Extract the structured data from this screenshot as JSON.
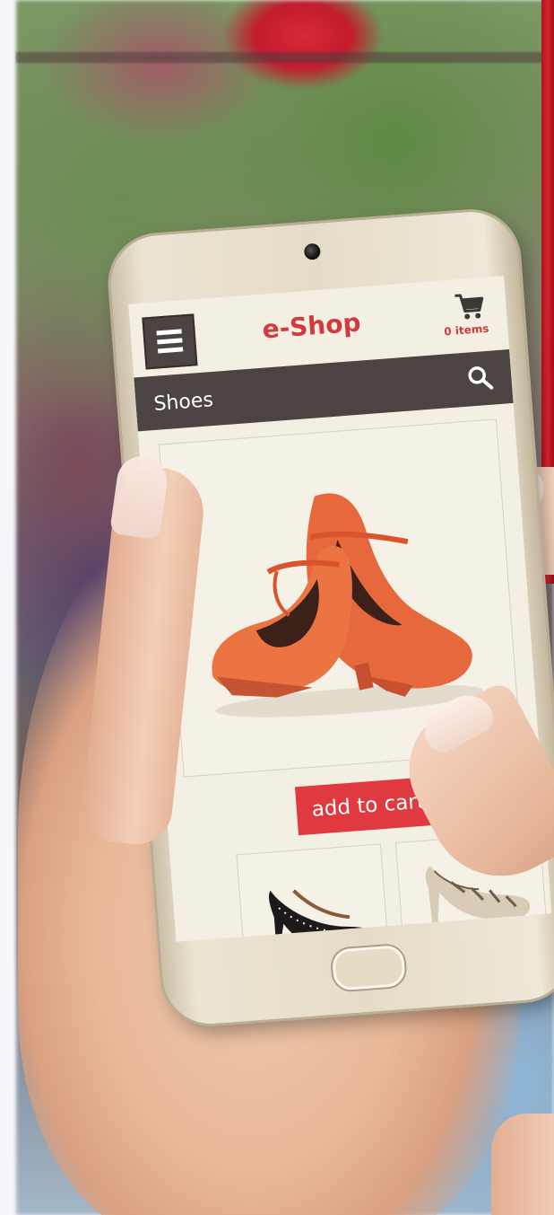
{
  "app": {
    "brand": "e-Shop",
    "cart_count_label": "0 items"
  },
  "search": {
    "value": "Shoes"
  },
  "product": {
    "add_to_cart_label": "add to cart"
  },
  "colors": {
    "accent_red": "#e0393f",
    "header_dark": "#4b4443",
    "screen_bg": "#f4efe3"
  },
  "icons": {
    "menu": "hamburger-menu-icon",
    "cart": "shopping-cart-icon",
    "search": "magnifier-search-icon"
  }
}
